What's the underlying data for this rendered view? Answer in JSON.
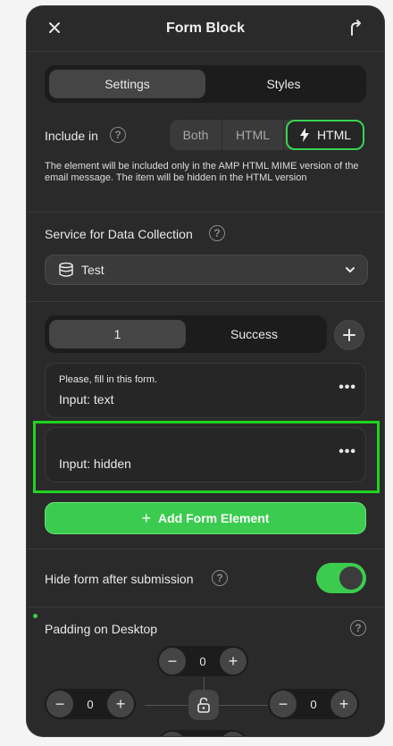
{
  "header": {
    "title": "Form Block"
  },
  "tabs": [
    {
      "label": "Settings",
      "active": true
    },
    {
      "label": "Styles",
      "active": false
    }
  ],
  "include_in": {
    "label": "Include in",
    "options": [
      {
        "label": "Both"
      },
      {
        "label": "HTML"
      },
      {
        "label": "HTML",
        "icon": "lightning-icon",
        "selected": true
      }
    ],
    "description": "The element will be included only in the AMP HTML MIME version of the email message. The item will be hidden in the HTML version"
  },
  "service": {
    "label": "Service for Data Collection",
    "selected": "Test"
  },
  "form_tabs": [
    {
      "label": "1",
      "active": true
    },
    {
      "label": "Success",
      "active": false
    }
  ],
  "elements": [
    {
      "hint": "Please, fill in this form.",
      "name": "Input: text"
    },
    {
      "hint": "",
      "name": "Input: hidden",
      "selected": true
    }
  ],
  "add_element": {
    "label": "Add Form Element"
  },
  "hide_form": {
    "label": "Hide form after submission",
    "enabled": true
  },
  "padding": {
    "label": "Padding on Desktop",
    "top": "0",
    "left": "0",
    "right": "0"
  },
  "colors": {
    "accent": "#3bcc4f",
    "selection": "#1fd41f",
    "panel": "#2a2a2a"
  }
}
